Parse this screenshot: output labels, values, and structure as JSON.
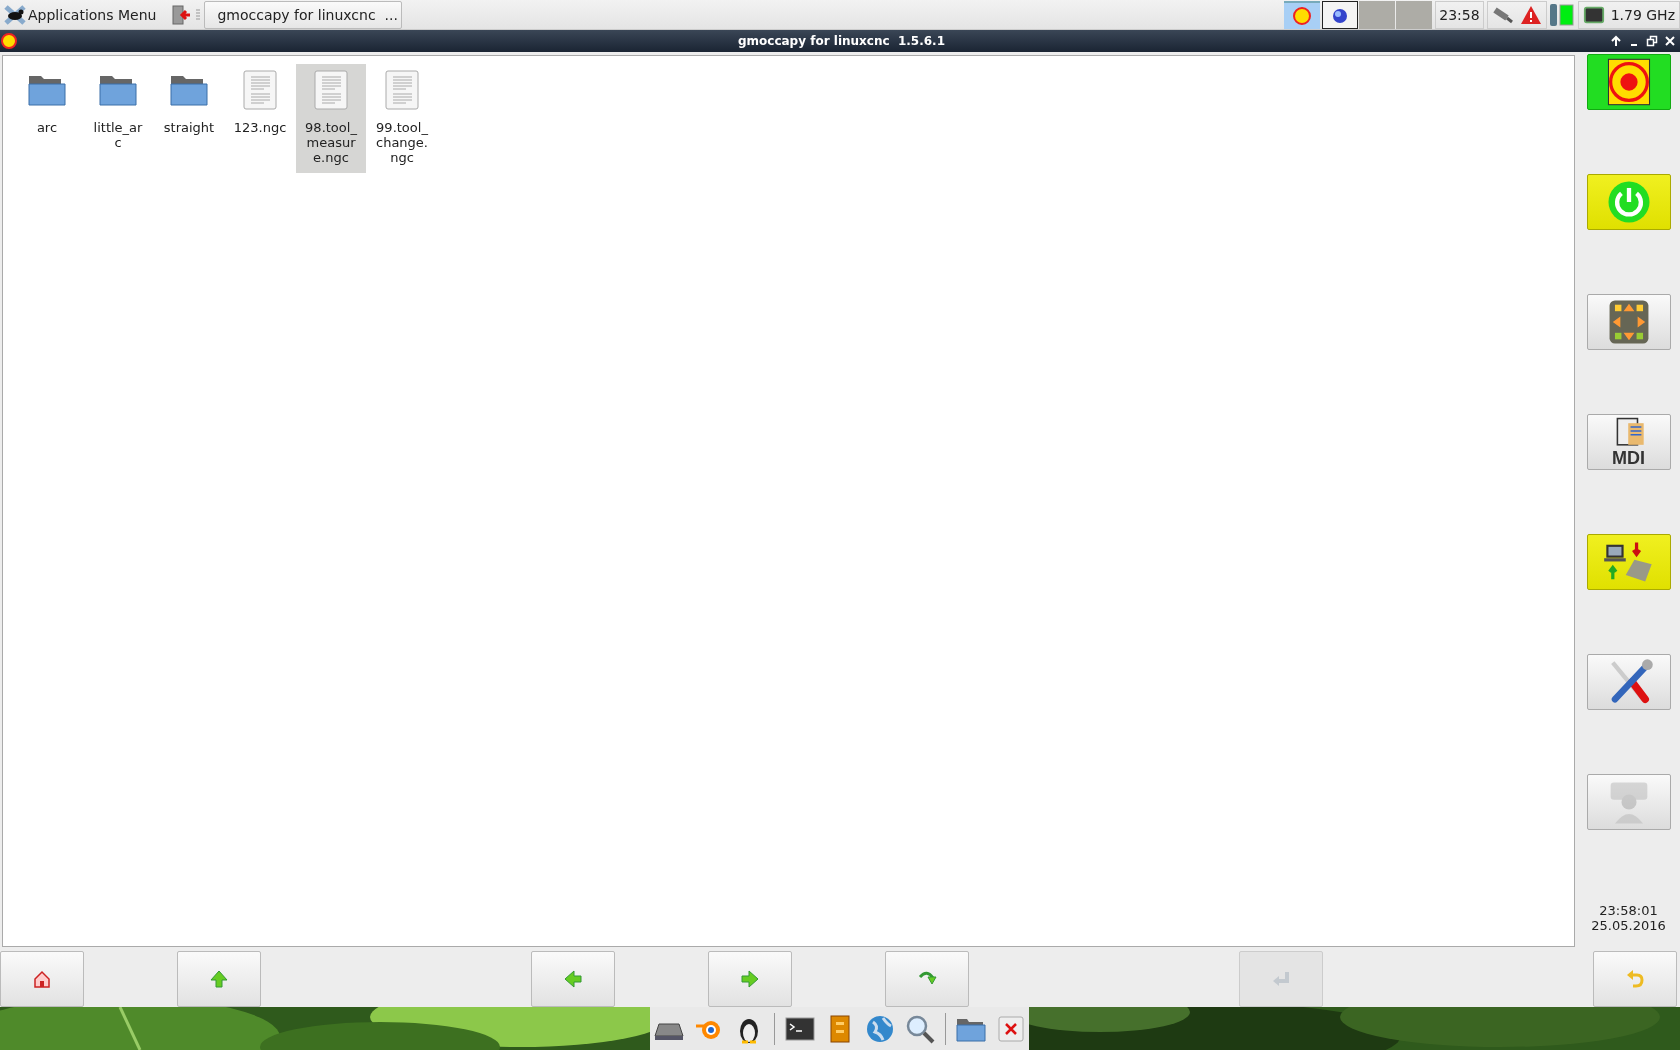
{
  "top_panel": {
    "apps_menu": "Applications Menu",
    "tasks": [
      {
        "label": "gmoccapy for linuxcnc  ...",
        "selected": true
      }
    ],
    "clock": "23:58",
    "cpu_freq": "1.79 GHz"
  },
  "window": {
    "title": "gmoccapy for linuxcnc  1.5.6.1"
  },
  "files": [
    {
      "name": "arc",
      "kind": "folder",
      "selected": false
    },
    {
      "name": "little_arc",
      "kind": "folder",
      "selected": false
    },
    {
      "name": "straight",
      "kind": "folder",
      "selected": false
    },
    {
      "name": "123.ngc",
      "kind": "file",
      "selected": false
    },
    {
      "name": "98.tool_measure.ngc",
      "kind": "file",
      "selected": true
    },
    {
      "name": "99.tool_change.ngc",
      "kind": "file",
      "selected": false
    }
  ],
  "side_buttons": [
    {
      "kind": "estop",
      "active": true,
      "disabled": false
    },
    {
      "kind": "power",
      "active": true,
      "disabled": false
    },
    {
      "kind": "jog",
      "active": false,
      "disabled": false
    },
    {
      "kind": "mdi",
      "label": "MDI",
      "active": false,
      "disabled": false
    },
    {
      "kind": "auto",
      "active": true,
      "disabled": false
    },
    {
      "kind": "settings",
      "active": false,
      "disabled": false
    },
    {
      "kind": "user",
      "active": false,
      "disabled": true
    }
  ],
  "clock": {
    "time": "23:58:01",
    "date": "25.05.2016"
  },
  "bottom_buttons": [
    {
      "kind": "home",
      "disabled": false
    },
    {
      "kind": "up",
      "disabled": false
    },
    {
      "kind": "back",
      "disabled": false
    },
    {
      "kind": "forward",
      "disabled": false
    },
    {
      "kind": "reload",
      "disabled": false
    },
    {
      "kind": "enter",
      "disabled": true
    },
    {
      "kind": "undo",
      "disabled": false
    }
  ],
  "dock": [
    {
      "kind": "drive"
    },
    {
      "kind": "blender"
    },
    {
      "kind": "penguin"
    },
    {
      "kind": "separator"
    },
    {
      "kind": "terminal"
    },
    {
      "kind": "archive"
    },
    {
      "kind": "globe"
    },
    {
      "kind": "search"
    },
    {
      "kind": "separator"
    },
    {
      "kind": "folder"
    },
    {
      "kind": "close"
    }
  ]
}
